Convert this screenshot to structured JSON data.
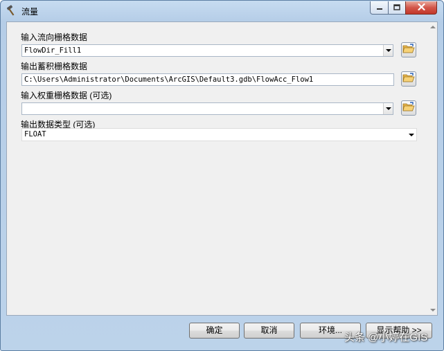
{
  "window": {
    "title": "流量"
  },
  "fields": {
    "input_flow_direction": {
      "label": "输入流向栅格数据",
      "value": "FlowDir_Fill1"
    },
    "output_accumulation": {
      "label": "输出蓄积栅格数据",
      "value": "C:\\Users\\Administrator\\Documents\\ArcGIS\\Default3.gdb\\FlowAcc_Flow1"
    },
    "input_weight": {
      "label": "输入权重栅格数据 (可选)",
      "value": ""
    },
    "output_data_type": {
      "label": "输出数据类型 (可选)",
      "value": "FLOAT"
    }
  },
  "buttons": {
    "ok": "确定",
    "cancel": "取消",
    "environments": "环境...",
    "show_help": "显示帮助 >>"
  },
  "watermark": "头条 @小婷在GIS",
  "icons": {
    "title": "hammer-icon",
    "browse": "folder-icon"
  },
  "colors": {
    "close_button": "#c9463a",
    "frame": "#b9d1ea",
    "client": "#f0f0f0"
  }
}
